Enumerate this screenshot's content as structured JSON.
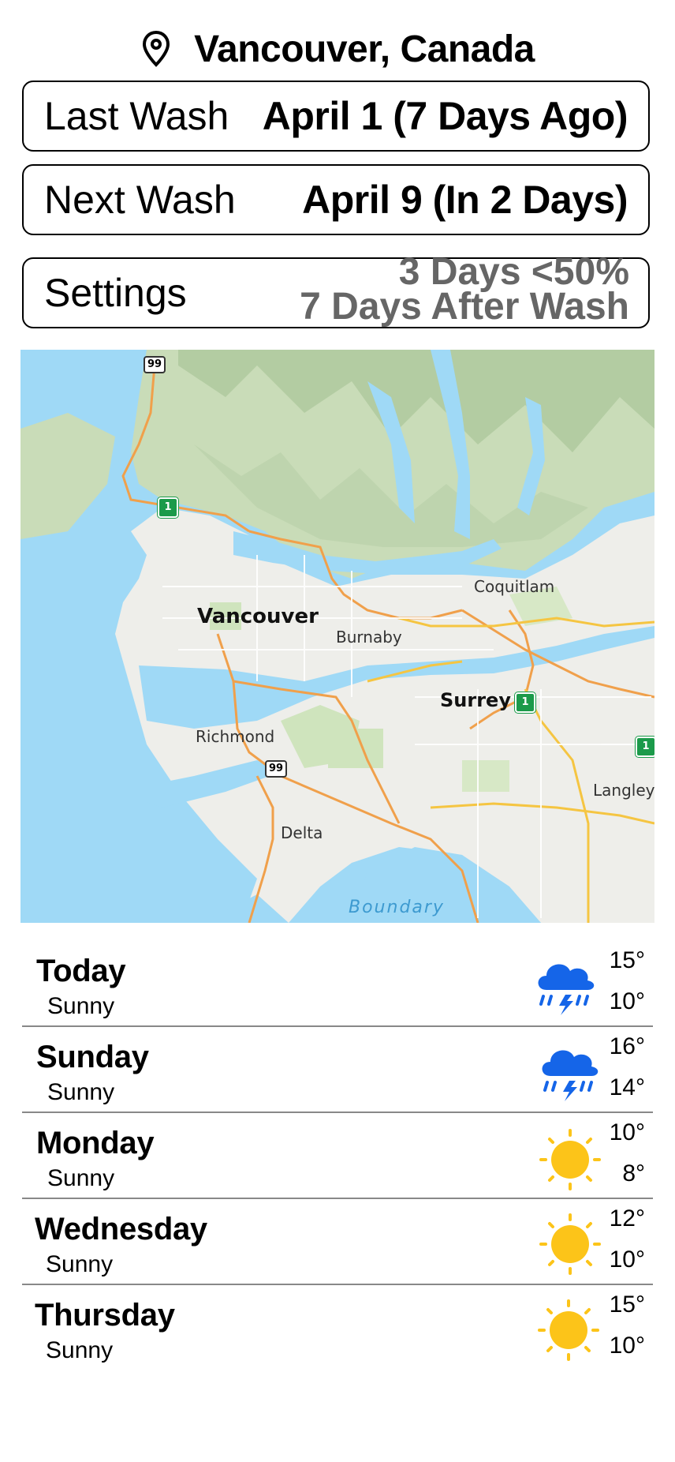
{
  "header": {
    "location_icon": "map-pin-icon",
    "city": "Vancouver, Canada"
  },
  "last_wash": {
    "label": "Last Wash",
    "value": "April 1 (7 Days Ago)"
  },
  "next_wash": {
    "label": "Next Wash",
    "value": "April 9 (In 2 Days)"
  },
  "settings": {
    "label": "Settings",
    "line1": "3 Days <50%",
    "line2": "7 Days After Wash"
  },
  "map": {
    "labels": {
      "coquitlam": "Coquitlam",
      "vancouver": "Vancouver",
      "burnaby": "Burnaby",
      "surrey": "Surrey",
      "richmond": "Richmond",
      "langley": "Langley",
      "delta": "Delta",
      "boundary": "Boundary"
    },
    "shields": {
      "hwy99": "99",
      "hwy1": "1"
    }
  },
  "forecast": [
    {
      "day": "Today",
      "condition": "Sunny",
      "icon": "thunderstorm-cloud-icon",
      "high": "15°",
      "low": "10°"
    },
    {
      "day": "Sunday",
      "condition": "Sunny",
      "icon": "thunderstorm-cloud-icon",
      "high": "16°",
      "low": "14°"
    },
    {
      "day": "Monday",
      "condition": "Sunny",
      "icon": "sun-icon",
      "high": "10°",
      "low": "8°"
    },
    {
      "day": "Wednesday",
      "condition": "Sunny",
      "icon": "sun-icon",
      "high": "12°",
      "low": "10°"
    },
    {
      "day": "Thursday",
      "condition": "Sunny",
      "icon": "sun-icon",
      "high": "15°",
      "low": "10°"
    }
  ],
  "colors": {
    "rain_icon": "#1565e8",
    "sun_icon": "#fcc419",
    "settings_value": "#666666"
  }
}
